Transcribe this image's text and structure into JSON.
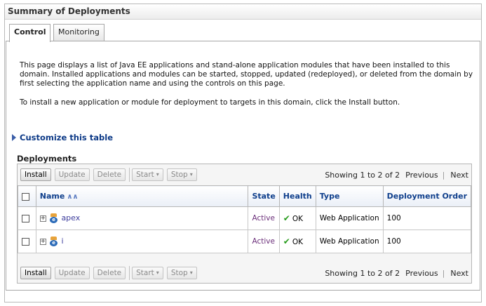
{
  "panel": {
    "title": "Summary of Deployments"
  },
  "tabs": [
    {
      "label": "Control",
      "active": true
    },
    {
      "label": "Monitoring",
      "active": false
    }
  ],
  "description": {
    "paragraph1": "This page displays a list of Java EE applications and stand-alone application modules that have been installed to this domain. Installed applications and modules can be started, stopped, updated (redeployed), or deleted from the domain by first selecting the application name and using the controls on this page.",
    "paragraph2": "To install a new application or module for deployment to targets in this domain, click the Install button."
  },
  "customize": {
    "label": "Customize this table"
  },
  "section": {
    "title": "Deployments"
  },
  "toolbar": {
    "install": "Install",
    "update": "Update",
    "delete": "Delete",
    "start": "Start",
    "stop": "Stop",
    "caret": "▾"
  },
  "pager": {
    "showing": "Showing 1 to 2 of 2",
    "previous": "Previous",
    "separator": "|",
    "next": "Next"
  },
  "columns": {
    "name": "Name",
    "state": "State",
    "health": "Health",
    "type": "Type",
    "order": "Deployment Order"
  },
  "rows": [
    {
      "name": "apex",
      "state": "Active",
      "health": "OK",
      "type": "Web Application",
      "order": "100"
    },
    {
      "name": "i",
      "state": "Active",
      "health": "OK",
      "type": "Web Application",
      "order": "100"
    }
  ],
  "colors": {
    "link": "#0f3f8c",
    "active_state": "#6b2f7a",
    "health_ok": "#2a9d1f"
  }
}
